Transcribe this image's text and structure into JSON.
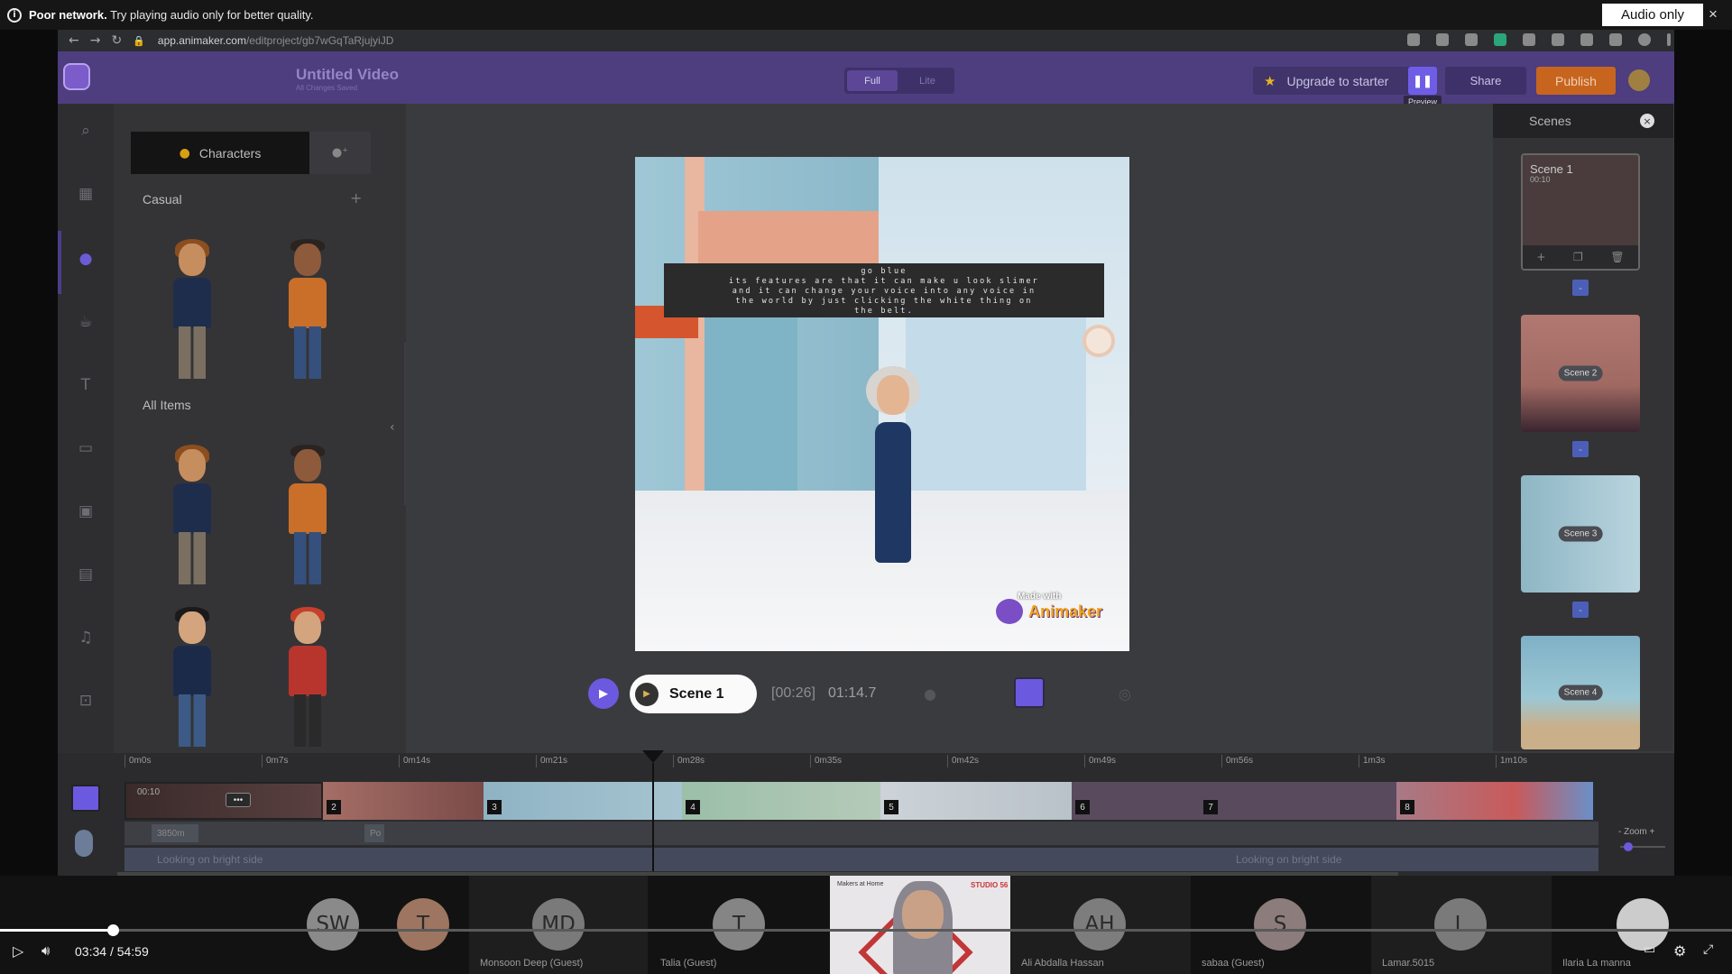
{
  "notice": {
    "bold": "Poor network.",
    "text": " Try playing audio only for better quality.",
    "audio_only_button": "Audio only",
    "close_symbol": "×"
  },
  "browser": {
    "url_domain": "app.animaker.com",
    "url_path": "/editproject/gb7wGqTaRjujyiJD"
  },
  "app": {
    "title": "Untitled Video",
    "save_status": "All Changes Saved",
    "mode_full": "Full",
    "mode_lite": "Lite",
    "upgrade_label": "Upgrade to starter",
    "preview_tooltip": "Preview",
    "share_label": "Share",
    "publish_label": "Publish",
    "accent": "#6b59e0",
    "publish_color": "#c7651e"
  },
  "panel": {
    "tab_characters": "Characters",
    "section_casual": "Casual",
    "section_all": "All Items"
  },
  "canvas": {
    "caption_line1": "go blue",
    "caption_line2": "its features are that it can make u look slimer",
    "caption_line3": "and it can change your voice into any voice in",
    "caption_line4": "the world by just clicking the white thing on",
    "caption_line5": "the belt.",
    "made_with": "Made with",
    "brand": "Animaker"
  },
  "playback": {
    "scene_label": "Scene 1",
    "current_time": "[00:26]",
    "duration": "01:14.7"
  },
  "scenes_panel": {
    "title": "Scenes",
    "scene1_name": "Scene 1",
    "scene1_duration": "00:10",
    "scene2_label": "Scene 2",
    "scene3_label": "Scene 3",
    "scene4_label": "Scene 4"
  },
  "timeline": {
    "ticks": [
      "0m0s",
      "0m7s",
      "0m14s",
      "0m21s",
      "0m28s",
      "0m35s",
      "0m42s",
      "0m49s",
      "0m56s",
      "1m3s",
      "1m10s"
    ],
    "scene1_duration": "00:10",
    "scene_numbers": [
      "2",
      "3",
      "4",
      "5",
      "6",
      "7",
      "8"
    ],
    "subtitle_chip1": "3850m",
    "subtitle_chip2": "Po",
    "music_label_1": "Looking on bright side",
    "music_label_2": "Looking on bright side",
    "zoom_label": "Zoom",
    "more_symbol": "•••"
  },
  "participants": [
    {
      "initials": "SW",
      "name": ""
    },
    {
      "initials": "T",
      "name": ""
    },
    {
      "initials": "MD",
      "name": "Monsoon Deep (Guest)"
    },
    {
      "initials": "T",
      "name": "Talia (Guest)"
    },
    {
      "initials": "AH",
      "name": "Ali Abdalla Hassan"
    },
    {
      "initials": "S",
      "name": "sabaa (Guest)"
    },
    {
      "initials": "L",
      "name": "Lamar.5015"
    },
    {
      "initials": "",
      "name": "Ilaria  La manna"
    }
  ],
  "video_tile": {
    "logo_left": "Makers at Home",
    "logo_right": "STUDIO 56"
  },
  "player": {
    "elapsed": "03:34",
    "separator": "/",
    "total": "54:59",
    "progress_fraction": 0.065
  }
}
